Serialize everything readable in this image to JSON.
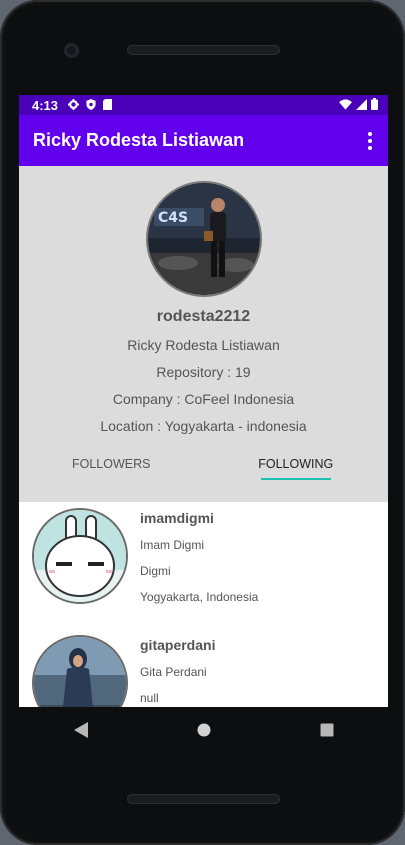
{
  "status_bar": {
    "time": "4:13",
    "icons": [
      "gear-icon",
      "shield-icon",
      "sd-card-icon"
    ],
    "right_icons": [
      "wifi-icon",
      "signal-icon",
      "battery-icon"
    ]
  },
  "app_bar": {
    "title": "Ricky Rodesta Listiawan",
    "menu_icon": "overflow-menu-icon"
  },
  "profile": {
    "username": "rodesta2212",
    "name": "Ricky Rodesta Listiawan",
    "repository": "Repository : 19",
    "company": "Company : CoFeel Indonesia",
    "location": "Location : Yogyakarta - indonesia"
  },
  "tabs": [
    {
      "label": "FOLLOWERS",
      "active": false
    },
    {
      "label": "FOLLOWING",
      "active": true
    }
  ],
  "accent_colors": {
    "app_bar": "#6200ee",
    "status_bar": "#4a00b8",
    "tab_indicator": "#19c3b0"
  },
  "following": [
    {
      "login": "imamdigmi",
      "name": "Imam Digmi",
      "company": "Digmi",
      "location": "Yogyakarta, Indonesia"
    },
    {
      "login": "gitaperdani",
      "name": "Gita Perdani",
      "company": "null",
      "location": ""
    }
  ],
  "nav_bar": [
    "back-icon",
    "home-icon",
    "recents-icon"
  ]
}
